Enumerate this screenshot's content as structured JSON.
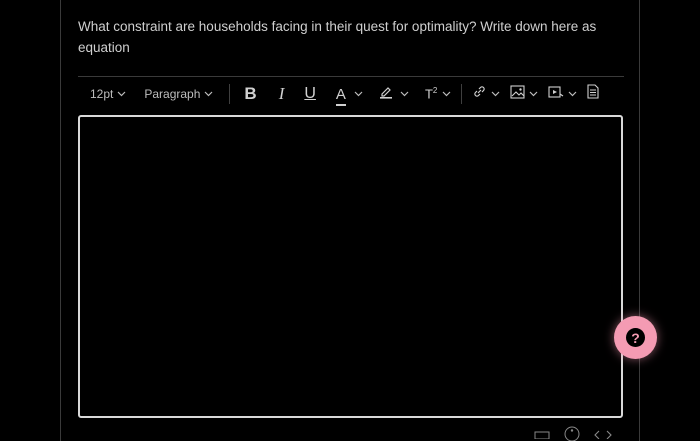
{
  "question": {
    "text": "What constraint are households facing in their quest for optimality? Write down here as equation"
  },
  "toolbar": {
    "font_size": "12pt",
    "block_format": "Paragraph",
    "bold_label": "B",
    "italic_label": "I",
    "underline_label": "U",
    "text_color_label": "A",
    "superscript_label": "T",
    "superscript_mark": "2",
    "icons": [
      "chevron-down-icon",
      "highlight-pen-icon",
      "link-icon",
      "image-icon",
      "media-icon",
      "document-icon"
    ]
  },
  "editor": {
    "content": ""
  },
  "help": {
    "symbol": "?",
    "color": "#f49bb3"
  }
}
